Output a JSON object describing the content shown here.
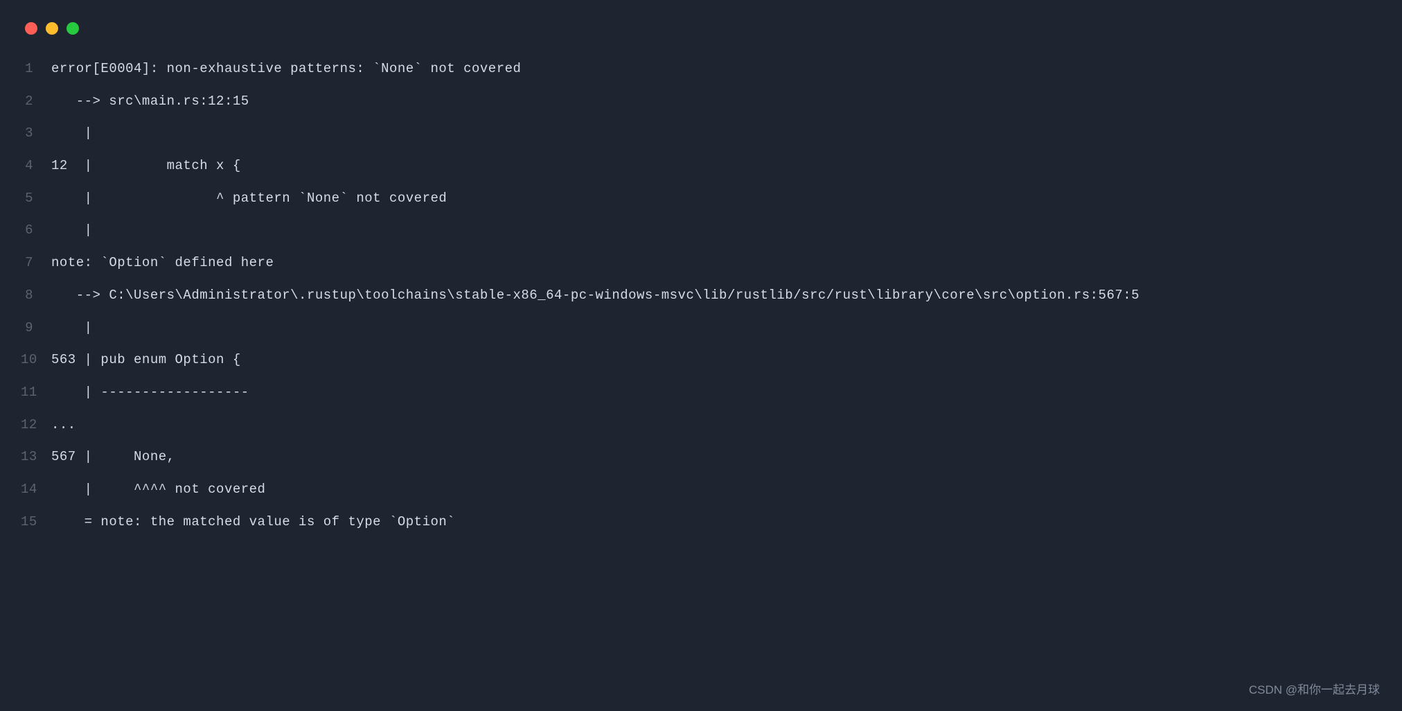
{
  "window": {
    "traffic_lights": [
      "red",
      "yellow",
      "green"
    ]
  },
  "code": {
    "lines": [
      {
        "num": "1",
        "text": "error[E0004]: non-exhaustive patterns: `None` not covered"
      },
      {
        "num": "2",
        "text": "   --> src\\main.rs:12:15"
      },
      {
        "num": "3",
        "text": "    |"
      },
      {
        "num": "4",
        "text": "12  |         match x {"
      },
      {
        "num": "5",
        "text": "    |               ^ pattern `None` not covered"
      },
      {
        "num": "6",
        "text": "    |"
      },
      {
        "num": "7",
        "text": "note: `Option` defined here"
      },
      {
        "num": "8",
        "text": "   --> C:\\Users\\Administrator\\.rustup\\toolchains\\stable-x86_64-pc-windows-msvc\\lib/rustlib/src/rust\\library\\core\\src\\option.rs:567:5"
      },
      {
        "num": "9",
        "text": "    |"
      },
      {
        "num": "10",
        "text": "563 | pub enum Option {"
      },
      {
        "num": "11",
        "text": "    | ------------------"
      },
      {
        "num": "12",
        "text": "..."
      },
      {
        "num": "13",
        "text": "567 |     None,"
      },
      {
        "num": "14",
        "text": "    |     ^^^^ not covered"
      },
      {
        "num": "15",
        "text": "    = note: the matched value is of type `Option`"
      }
    ]
  },
  "watermark": "CSDN @和你一起去月球"
}
